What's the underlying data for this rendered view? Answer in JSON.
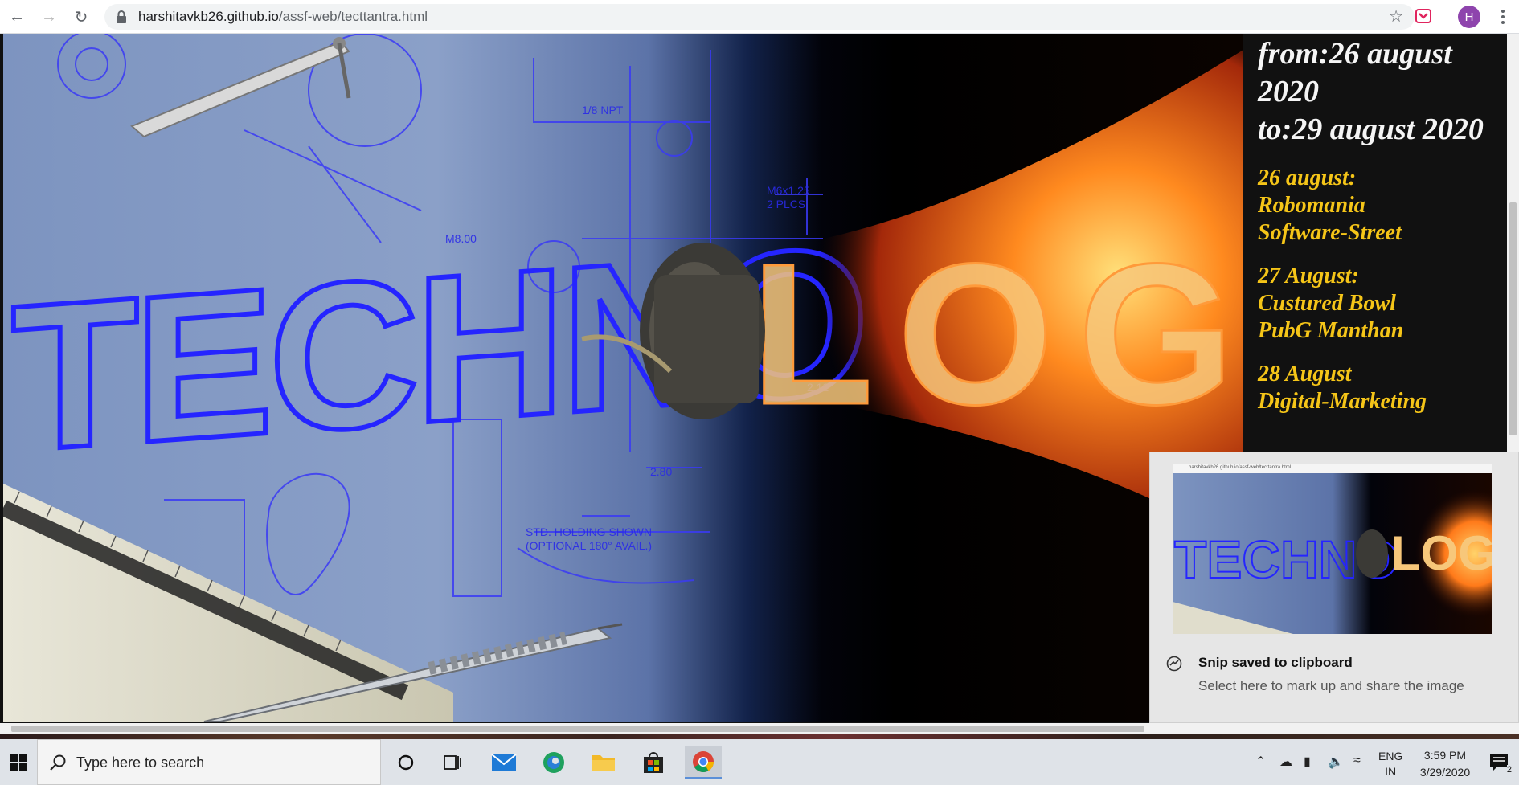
{
  "browser": {
    "url_host": "harshitavkb26.github.io",
    "url_path": "/assf-web/tecttantra.html",
    "profile_initial": "H"
  },
  "page": {
    "schedule_header": [
      "from:26 august",
      "2020",
      "to:29 august 2020"
    ],
    "days": [
      {
        "title": "26 august:",
        "events": [
          "Robomania",
          "Software-Street"
        ]
      },
      {
        "title": "27 August:",
        "events": [
          "Custured Bowl",
          "PubG Manthan"
        ]
      },
      {
        "title": "28 August",
        "events": [
          "Digital-Marketing"
        ]
      }
    ],
    "hero_word_left": "TECHNO",
    "hero_word_right": "LOGY"
  },
  "toast": {
    "thumb_url": "harshitavkb26.github.io/assf-web/tecttantra.html",
    "title": "Snip saved to clipboard",
    "body": "Select here to mark up and share the image"
  },
  "taskbar": {
    "search_placeholder": "Type here to search",
    "lang_line1": "ENG",
    "lang_line2": "IN",
    "time": "3:59 PM",
    "date": "3/29/2020",
    "notification_count": "2"
  },
  "colors": {
    "accent_yellow": "#f5c518",
    "blueprint": "#2f2ff0",
    "fire": "#ff7a1a"
  }
}
